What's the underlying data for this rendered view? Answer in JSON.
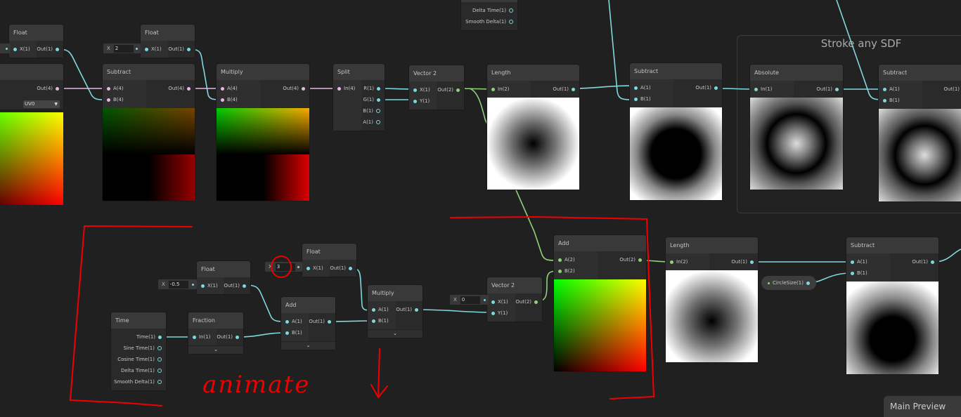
{
  "group": {
    "title": "Stroke any SDF"
  },
  "nodes": [
    {
      "title": "Float",
      "inputs": [
        "X(1)"
      ],
      "outputs": [
        "Out(1)"
      ]
    },
    {
      "title": "Float",
      "inputs": [
        "X(1)"
      ],
      "outputs": [
        "Out(1)"
      ]
    },
    {
      "title": "",
      "inputs": [],
      "outputs": [
        "Out(4)"
      ],
      "dropdown": "UV0"
    },
    {
      "title": "Subtract",
      "inputs": [
        "A(4)",
        "B(4)"
      ],
      "outputs": [
        "Out(4)"
      ]
    },
    {
      "title": "Multiply",
      "inputs": [
        "A(4)",
        "B(4)"
      ],
      "outputs": [
        "Out(4)"
      ]
    },
    {
      "title": "Split",
      "inputs": [
        "In(4)"
      ],
      "outputs": [
        "R(1)",
        "G(1)",
        "B(1)",
        "A(1)"
      ]
    },
    {
      "title": "Vector 2",
      "inputs": [
        "X(1)",
        "Y(1)"
      ],
      "outputs": [
        "Out(2)"
      ]
    },
    {
      "title": "Length",
      "inputs": [
        "In(2)"
      ],
      "outputs": [
        "Out(1)"
      ]
    },
    {
      "title": "Subtract",
      "inputs": [
        "A(1)",
        "B(1)"
      ],
      "outputs": [
        "Out(1)"
      ]
    },
    {
      "title": "Absolute",
      "inputs": [
        "In(1)"
      ],
      "outputs": [
        "Out(1)"
      ]
    },
    {
      "title": "Subtract",
      "inputs": [
        "A(1)",
        "B(1)"
      ],
      "outputs": [
        "Out(1)"
      ]
    },
    {
      "title": "",
      "inputs": [],
      "outputs": [
        "Delta Time(1)",
        "Smooth Delta(1)"
      ]
    },
    {
      "title": "Float",
      "inputs": [
        "X(1)"
      ],
      "outputs": [
        "Out(1)"
      ]
    },
    {
      "title": "Float",
      "inputs": [
        "X(1)"
      ],
      "outputs": [
        "Out(1)"
      ]
    },
    {
      "title": "Time",
      "inputs": [],
      "outputs": [
        "Time(1)",
        "Sine Time(1)",
        "Cosine Time(1)",
        "Delta Time(1)",
        "Smooth Delta(1)"
      ]
    },
    {
      "title": "Fraction",
      "inputs": [
        "In(1)"
      ],
      "outputs": [
        "Out(1)"
      ]
    },
    {
      "title": "Add",
      "inputs": [
        "A(1)",
        "B(1)"
      ],
      "outputs": [
        "Out(1)"
      ]
    },
    {
      "title": "Multiply",
      "inputs": [
        "A(1)",
        "B(1)"
      ],
      "outputs": [
        "Out(1)"
      ]
    },
    {
      "title": "Vector 2",
      "inputs": [
        "X(1)",
        "Y(1)"
      ],
      "outputs": [
        "Out(2)"
      ]
    },
    {
      "title": "Add",
      "inputs": [
        "A(2)",
        "B(2)"
      ],
      "outputs": [
        "Out(2)"
      ]
    },
    {
      "title": "Length",
      "inputs": [
        "In(2)"
      ],
      "outputs": [
        "Out(1)"
      ]
    },
    {
      "title": "Subtract",
      "inputs": [
        "A(1)",
        "B(1)"
      ],
      "outputs": [
        "Out(1)"
      ]
    }
  ],
  "fields": [
    {
      "label": "X",
      "value": "2"
    },
    {
      "label": "X",
      "value": "-0.5"
    },
    {
      "label": "X",
      "value": "3"
    },
    {
      "label": "X",
      "value": "0"
    }
  ],
  "property": {
    "label": "CircleSize(1)"
  },
  "main_preview": {
    "title": "Main Preview"
  },
  "annotation": {
    "text": "animate"
  },
  "colors": {
    "vector1": "#7fd8dc",
    "vector2": "#8fd27a",
    "vector4": "#e4b8de",
    "annotation": "#e00000"
  },
  "icons": {
    "collapse": "chevron-down-icon",
    "dropdown": "triangle-down-icon"
  }
}
